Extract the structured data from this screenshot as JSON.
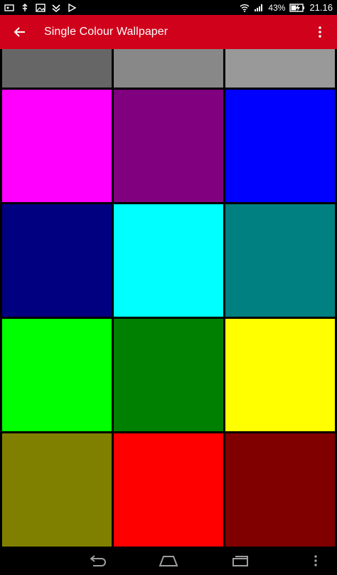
{
  "status_bar": {
    "icons": [
      "notification-icon",
      "usb-icon",
      "image-icon",
      "download-icon",
      "play-store-icon"
    ],
    "battery_percent": "43%",
    "time": "21.16"
  },
  "app_bar": {
    "title": "Single Colour Wallpaper",
    "back_icon": "arrow-back-icon",
    "menu_icon": "more-vert-icon"
  },
  "colors": {
    "app_bar": "#d0021b",
    "grid_gap": "#000000"
  },
  "swatches": [
    {
      "name": "gray",
      "color": "#666666"
    },
    {
      "name": "dark-gray",
      "color": "#888888"
    },
    {
      "name": "light-gray",
      "color": "#999999"
    },
    {
      "name": "magenta",
      "color": "#ff00ff"
    },
    {
      "name": "purple",
      "color": "#800080"
    },
    {
      "name": "blue",
      "color": "#0000ff"
    },
    {
      "name": "navy",
      "color": "#000080"
    },
    {
      "name": "cyan",
      "color": "#00ffff"
    },
    {
      "name": "teal",
      "color": "#008080"
    },
    {
      "name": "lime",
      "color": "#00ff00"
    },
    {
      "name": "green",
      "color": "#008000"
    },
    {
      "name": "yellow",
      "color": "#ffff00"
    },
    {
      "name": "olive",
      "color": "#808000"
    },
    {
      "name": "red",
      "color": "#ff0000"
    },
    {
      "name": "maroon",
      "color": "#800000"
    }
  ],
  "nav_bar": {
    "buttons": [
      "back-nav-icon",
      "home-nav-icon",
      "recents-nav-icon",
      "menu-nav-icon"
    ]
  }
}
